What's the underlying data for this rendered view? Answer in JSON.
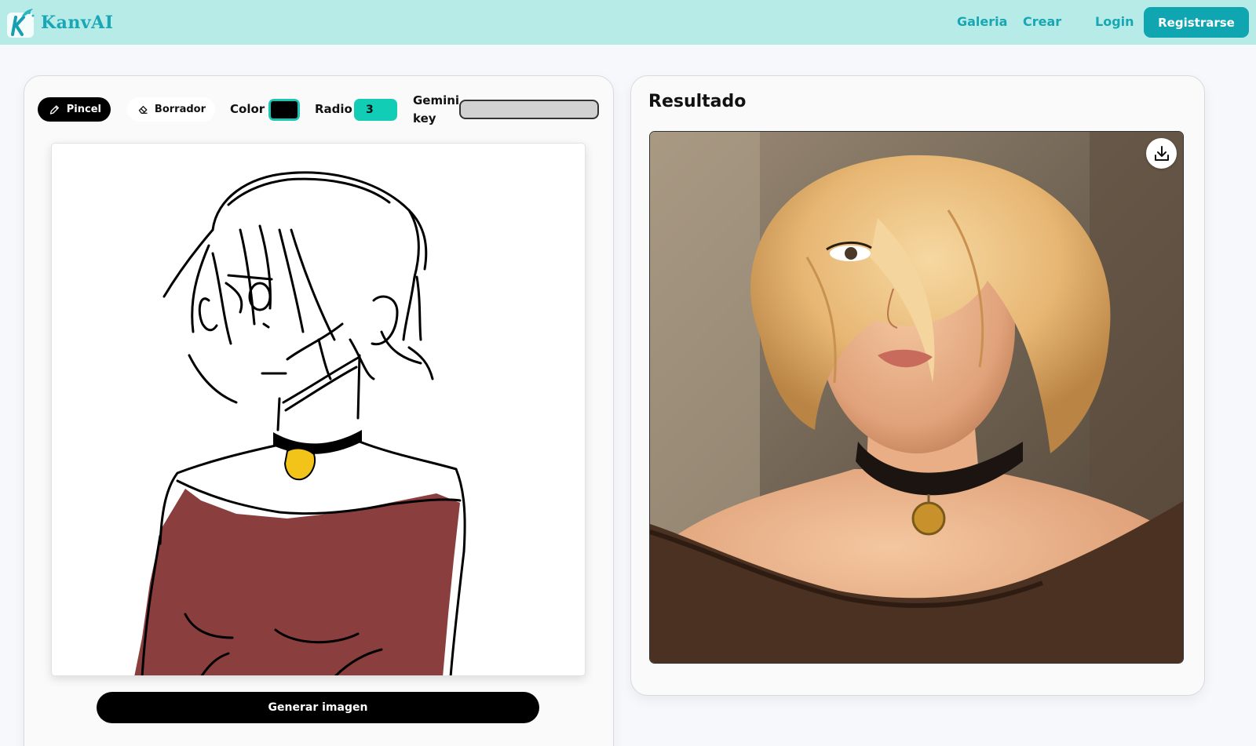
{
  "brand": {
    "name": "KanvAI"
  },
  "nav": {
    "gallery": "Galeria",
    "create": "Crear",
    "login": "Login",
    "register": "Registrarse"
  },
  "toolbar": {
    "brush_label": "Pincel",
    "eraser_label": "Borrador",
    "color_label": "Color",
    "color_value": "#000000",
    "radius_label": "Radio",
    "radius_value": "3",
    "gemini_label_1": "Gemini",
    "gemini_label_2": "key",
    "gemini_value": ""
  },
  "canvas": {
    "generate_label": "Generar imagen"
  },
  "result": {
    "title": "Resultado"
  },
  "colors": {
    "navbar": "#b6ebe8",
    "accent": "#0fa5b1",
    "teal_input": "#12cdb5",
    "shirt": "#8a3e3e",
    "pendant": "#f2c318"
  },
  "icons": {
    "brush": "pencil-icon",
    "eraser": "eraser-icon",
    "download": "download-icon"
  }
}
